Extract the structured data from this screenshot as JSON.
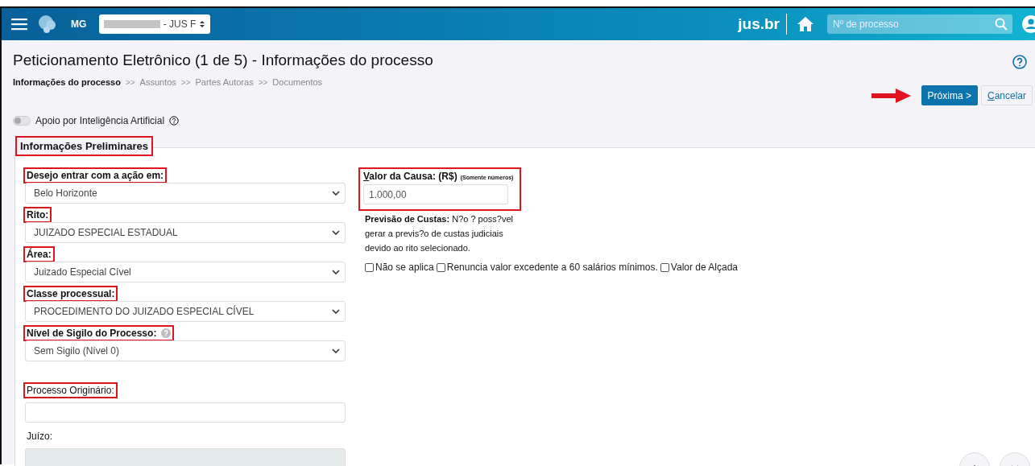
{
  "header": {
    "state": "MG",
    "unit_selector": {
      "value": "- JUS F"
    },
    "brand": "jus.br",
    "search": {
      "placeholder": "Nº de processo"
    }
  },
  "page_title": "Peticionamento Eletrônico (1 de 5) - Informações do processo",
  "breadcrumb": [
    {
      "label": "Informações do processo",
      "selected": true
    },
    {
      "separator": ">>",
      "label": "Assuntos",
      "selected": false
    },
    {
      "separator": ">>",
      "label": "Partes Autoras",
      "selected": false
    },
    {
      "separator": ">>",
      "label": "Documentos",
      "selected": false
    }
  ],
  "actions": [
    {
      "label": "Próxima >",
      "kind": "primary",
      "marked": true
    },
    {
      "label": "Cancelar",
      "kind": "secondary",
      "marked": false
    }
  ],
  "ai_toggle": {
    "label": "Apoio por Inteligência Artificial",
    "on": false
  },
  "section": {
    "legend": "Informações Preliminares",
    "highlighted": true
  },
  "left_fields": [
    {
      "label": "Desejo entrar com a ação em:",
      "kind": "select",
      "value": "Belo Horizonte",
      "bold": true,
      "highlighted": true,
      "help": false
    },
    {
      "label": "Rito:",
      "kind": "select",
      "value": "JUIZADO ESPECIAL ESTADUAL",
      "bold": true,
      "highlighted": true,
      "help": false
    },
    {
      "label": "Área:",
      "kind": "select",
      "value": "Juizado Especial Cível",
      "bold": true,
      "highlighted": true,
      "help": false
    },
    {
      "label": "Classe processual:",
      "kind": "select",
      "value": "PROCEDIMENTO DO JUIZADO ESPECIAL CÍVEL",
      "bold": true,
      "highlighted": true,
      "help": false
    },
    {
      "label": "Nível de Sigilo do Processo:",
      "kind": "select",
      "value": "Sem Sigilo (Nível 0)",
      "bold": true,
      "highlighted": true,
      "help": true
    },
    {
      "label": "Processo Originário:",
      "kind": "input",
      "bold": false,
      "highlighted": true,
      "help": false,
      "disabled": false
    },
    {
      "label": "Juízo:",
      "kind": "input",
      "bold": false,
      "highlighted": false,
      "help": false,
      "disabled": true
    }
  ],
  "valor_causa": {
    "label": "Valor da Causa: (R$)",
    "hint": "(Somente números)",
    "value": "1.000,00",
    "highlighted": true
  },
  "custas": "**Previsão de Custas:**  N?o ? poss?vel gerar a previs?o de custas judiciais devido ao rito selecionado.",
  "options": [
    {
      "label": "Não se aplica",
      "checked": false
    },
    {
      "label": "Renuncia valor excedente a 60 salários mínimos.",
      "checked": false
    },
    {
      "label": "Valor de Alçada",
      "checked": false
    }
  ]
}
